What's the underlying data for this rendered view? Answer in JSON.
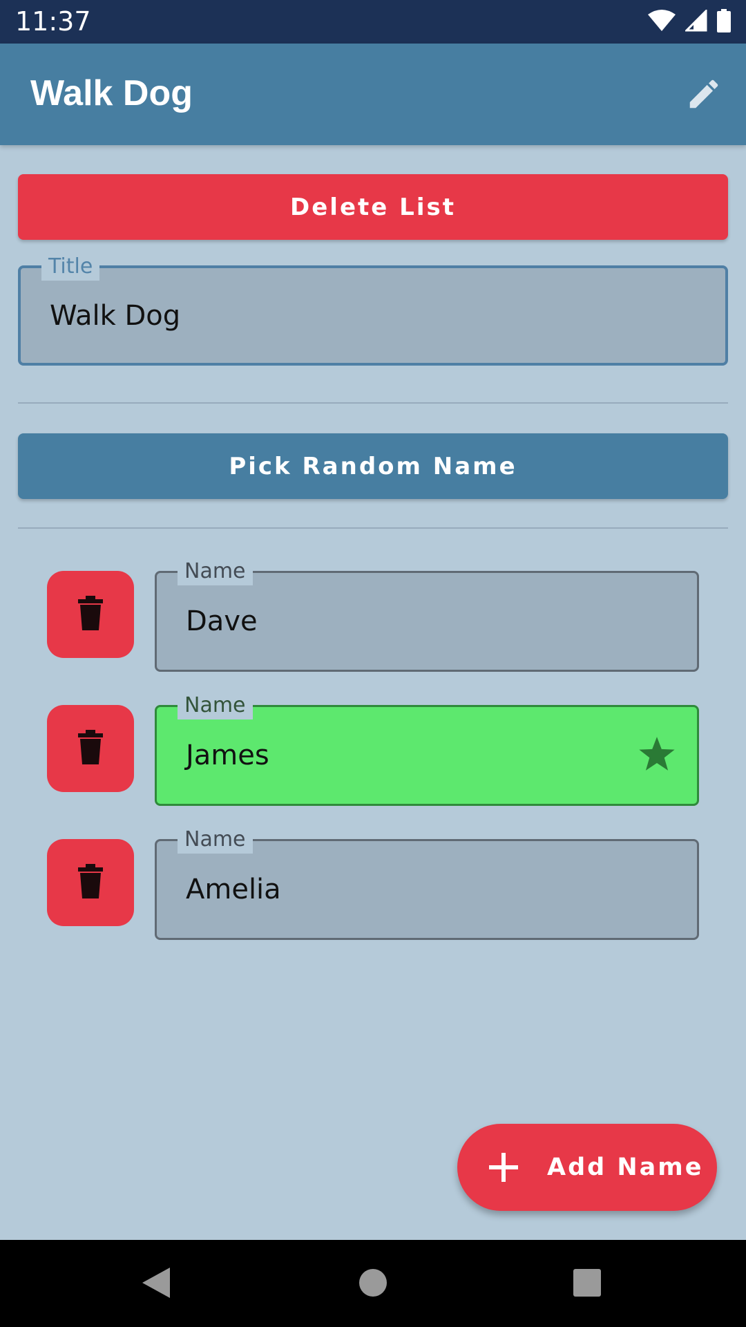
{
  "status_bar": {
    "time": "11:37",
    "icons": [
      "wifi-icon",
      "signal-icon",
      "battery-icon"
    ]
  },
  "app_bar": {
    "title": "Walk Dog",
    "edit_icon": "pencil-icon"
  },
  "actions": {
    "delete_label": "Delete List",
    "pick_label": "Pick Random Name"
  },
  "title_field": {
    "label": "Title",
    "value": "Walk Dog"
  },
  "names": [
    {
      "label": "Name",
      "value": "Dave",
      "selected": false
    },
    {
      "label": "Name",
      "value": "James",
      "selected": true
    },
    {
      "label": "Name",
      "value": "Amelia",
      "selected": false
    }
  ],
  "fab": {
    "label": "Add Name",
    "icon": "plus-icon"
  },
  "colors": {
    "primary": "#477ea1",
    "danger": "#e73848",
    "selected": "#5de86e",
    "background": "#b5cad9",
    "status_bar": "#1c3156"
  }
}
